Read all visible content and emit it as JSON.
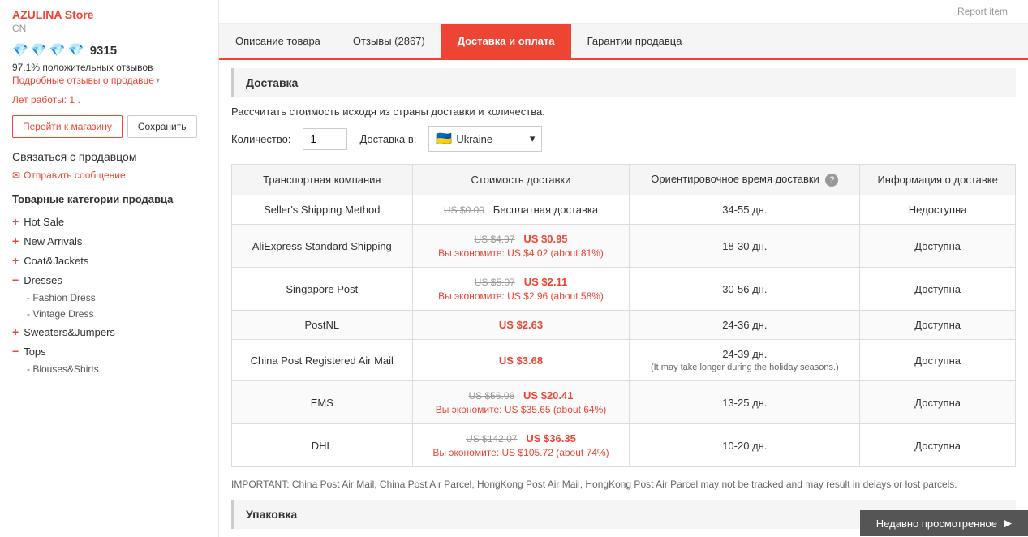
{
  "header": {
    "report_item": "Report item"
  },
  "tabs": {
    "items": [
      {
        "id": "description",
        "label": "Описание товара",
        "active": false
      },
      {
        "id": "reviews",
        "label": "Отзывы (2867)",
        "active": false
      },
      {
        "id": "delivery",
        "label": "Доставка и оплата",
        "active": true
      },
      {
        "id": "guarantee",
        "label": "Гарантии продавца",
        "active": false
      }
    ]
  },
  "sidebar": {
    "store_name": "AZULINA Store",
    "store_country": "CN",
    "diamonds": "💎💎💎💎",
    "rating_num": "9315",
    "positive_text": "97.1% положительных отзывов",
    "detail_link": "Подробные отзывы о продавце",
    "years_label": "Лет работы:",
    "years_value": "1",
    "btn_store": "Перейти к магазину",
    "btn_save": "Сохранить",
    "contact_title": "Связаться с продавцом",
    "msg_link": "Отправить сообщение",
    "categories_title": "Товарные категории продавца",
    "categories": [
      {
        "label": "Hot Sale",
        "prefix": "+",
        "expanded": false
      },
      {
        "label": "New Arrivals",
        "prefix": "+",
        "expanded": false
      },
      {
        "label": "Coat&Jackets",
        "prefix": "+",
        "expanded": false
      },
      {
        "label": "Dresses",
        "prefix": "-",
        "expanded": true,
        "children": [
          "Fashion Dress",
          "Vintage Dress"
        ]
      },
      {
        "label": "Sweaters&Jumpers",
        "prefix": "+",
        "expanded": false
      },
      {
        "label": "Tops",
        "prefix": "-",
        "expanded": true,
        "children": [
          "Blouses&Shirts"
        ]
      }
    ]
  },
  "delivery": {
    "section_title": "Доставка",
    "calc_text": "Рассчитать стоимость исходя из страны доставки и количества.",
    "qty_label": "Количество:",
    "qty_value": "1",
    "dest_label": "Доставка в:",
    "dest_country": "Ukraine",
    "help_icon": "?",
    "table_headers": {
      "carrier": "Транспортная компания",
      "cost": "Стоимость доставки",
      "time": "Ориентировочное время доставки",
      "info": "Информация о доставке"
    },
    "rows": [
      {
        "carrier": "Seller's Shipping Method",
        "old_price": "US $0.00",
        "new_price": "",
        "free": "Бесплатная доставка",
        "save": "",
        "time": "34-55 дн.",
        "available": "Недоступна"
      },
      {
        "carrier": "AliExpress Standard Shipping",
        "old_price": "US $4.97",
        "new_price": "US $0.95",
        "free": "",
        "save": "Вы экономите: US $4.02 (about 81%)",
        "time": "18-30 дн.",
        "available": "Доступна"
      },
      {
        "carrier": "Singapore Post",
        "old_price": "US $5.07",
        "new_price": "US $2.11",
        "free": "",
        "save": "Вы экономите: US $2.96 (about 58%)",
        "time": "30-56 дн.",
        "available": "Доступна"
      },
      {
        "carrier": "PostNL",
        "old_price": "",
        "new_price": "US $2.63",
        "free": "",
        "save": "",
        "time": "24-36 дн.",
        "available": "Доступна"
      },
      {
        "carrier": "China Post Registered Air Mail",
        "old_price": "",
        "new_price": "US $3.68",
        "free": "",
        "save": "",
        "time": "24-39 дн.",
        "time_note": "(It may take longer during the holiday seasons.)",
        "available": "Доступна"
      },
      {
        "carrier": "EMS",
        "old_price": "US $56.06",
        "new_price": "US $20.41",
        "free": "",
        "save": "Вы экономите: US $35.65 (about 64%)",
        "time": "13-25 дн.",
        "available": "Доступна"
      },
      {
        "carrier": "DHL",
        "old_price": "US $142.07",
        "new_price": "US $36.35",
        "free": "",
        "save": "Вы экономите: US $105.72 (about 74%)",
        "time": "10-20 дн.",
        "available": "Доступна"
      }
    ],
    "important_note": "IMPORTANT: China Post Air Mail, China Post Air Parcel, HongKong Post Air Mail, HongKong Post Air Parcel may not be tracked and may result in delays or lost parcels.",
    "packaging_title": "Упаковка"
  },
  "recently_viewed": "Недавно просмотренное"
}
